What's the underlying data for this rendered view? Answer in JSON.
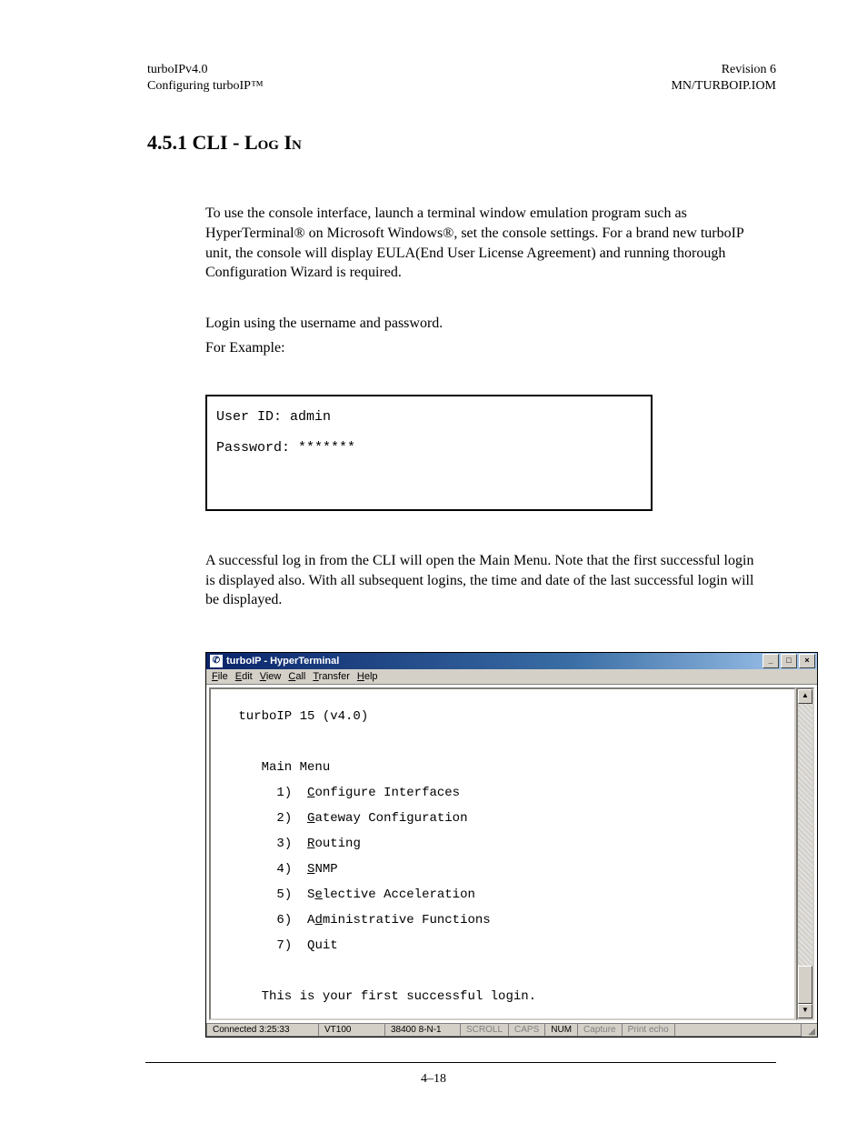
{
  "header": {
    "left_line1": "turboIPv4.0",
    "left_line2": "Configuring turboIP™",
    "right_line1": "Revision 6",
    "right_line2": "MN/TURBOIP.IOM"
  },
  "section": {
    "number": "4.5.1",
    "title_main": " CLI  - L",
    "title_sc": "og In"
  },
  "paragraphs": {
    "p1": "To use the console interface, launch a terminal window emulation program such as HyperTerminal® on Microsoft Windows®, set the console settings. For a brand new turboIP unit,  the console will display EULA(End User License Agreement) and running thorough Configuration Wizard is required.",
    "p2": "Login using the username and password.",
    "p3": "For Example:",
    "p4": "A successful log in from the CLI will open the Main Menu. Note that the first successful login is displayed also. With all subsequent logins, the time and date of the last successful login will be displayed."
  },
  "login_box": {
    "line1": "User ID: admin",
    "line2": "Password: *******"
  },
  "hyperterminal": {
    "title": "turboIP - HyperTerminal",
    "win_buttons": {
      "min": "_",
      "max": "□",
      "close": "×"
    },
    "menus": [
      {
        "u": "F",
        "rest": "ile"
      },
      {
        "u": "E",
        "rest": "dit"
      },
      {
        "u": "V",
        "rest": "iew"
      },
      {
        "u": "C",
        "rest": "all"
      },
      {
        "u": "T",
        "rest": "ransfer"
      },
      {
        "u": "H",
        "rest": "elp"
      }
    ],
    "terminal": {
      "line_title": " turboIP 15 (v4.0)",
      "line_menu": "    Main Menu",
      "items": [
        {
          "n": "1",
          "pre": "",
          "u": "C",
          "post": "onfigure Interfaces"
        },
        {
          "n": "2",
          "pre": "",
          "u": "G",
          "post": "ateway Configuration"
        },
        {
          "n": "3",
          "pre": "",
          "u": "R",
          "post": "outing"
        },
        {
          "n": "4",
          "pre": "",
          "u": "S",
          "post": "NMP"
        },
        {
          "n": "5",
          "pre": "S",
          "u": "e",
          "post": "lective Acceleration"
        },
        {
          "n": "6",
          "pre": "A",
          "u": "d",
          "post": "ministrative Functions"
        },
        {
          "n": "7",
          "pre": "",
          "u": "",
          "post": "Quit"
        }
      ],
      "line_msg": "    This is your first successful login."
    },
    "status": {
      "connected": "Connected 3:25:33",
      "term": "VT100",
      "baud": "38400 8-N-1",
      "scroll": "SCROLL",
      "caps": "CAPS",
      "num": "NUM",
      "capture": "Capture",
      "printecho": "Print echo"
    }
  },
  "footer": {
    "page": "4–18"
  }
}
